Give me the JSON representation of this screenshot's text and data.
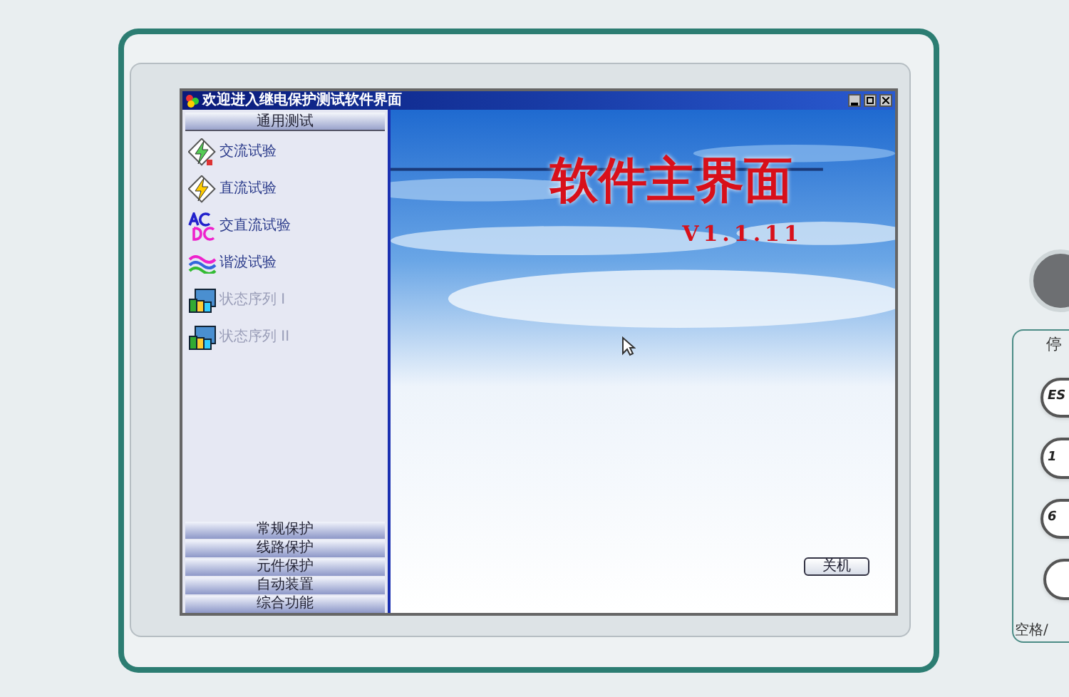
{
  "window": {
    "title": "欢迎进入继电保护测试软件界面"
  },
  "sidebar": {
    "header": "通用测试",
    "items": [
      {
        "label": "交流试验",
        "disabled": false
      },
      {
        "label": "直流试验",
        "disabled": false
      },
      {
        "label": "交直流试验",
        "disabled": false
      },
      {
        "label": "谐波试验",
        "disabled": false
      },
      {
        "label": "状态序列 I",
        "disabled": true
      },
      {
        "label": "状态序列 II",
        "disabled": true
      }
    ],
    "groups": [
      "常规保护",
      "线路保护",
      "元件保护",
      "自动装置",
      "综合功能"
    ]
  },
  "main": {
    "title": "软件主界面",
    "version": "V1.1.11",
    "shutdown_button": "关机"
  },
  "keypad": {
    "label_top": "停",
    "keys": [
      "ES",
      "1",
      "6"
    ],
    "label_bottom": "空格/"
  }
}
